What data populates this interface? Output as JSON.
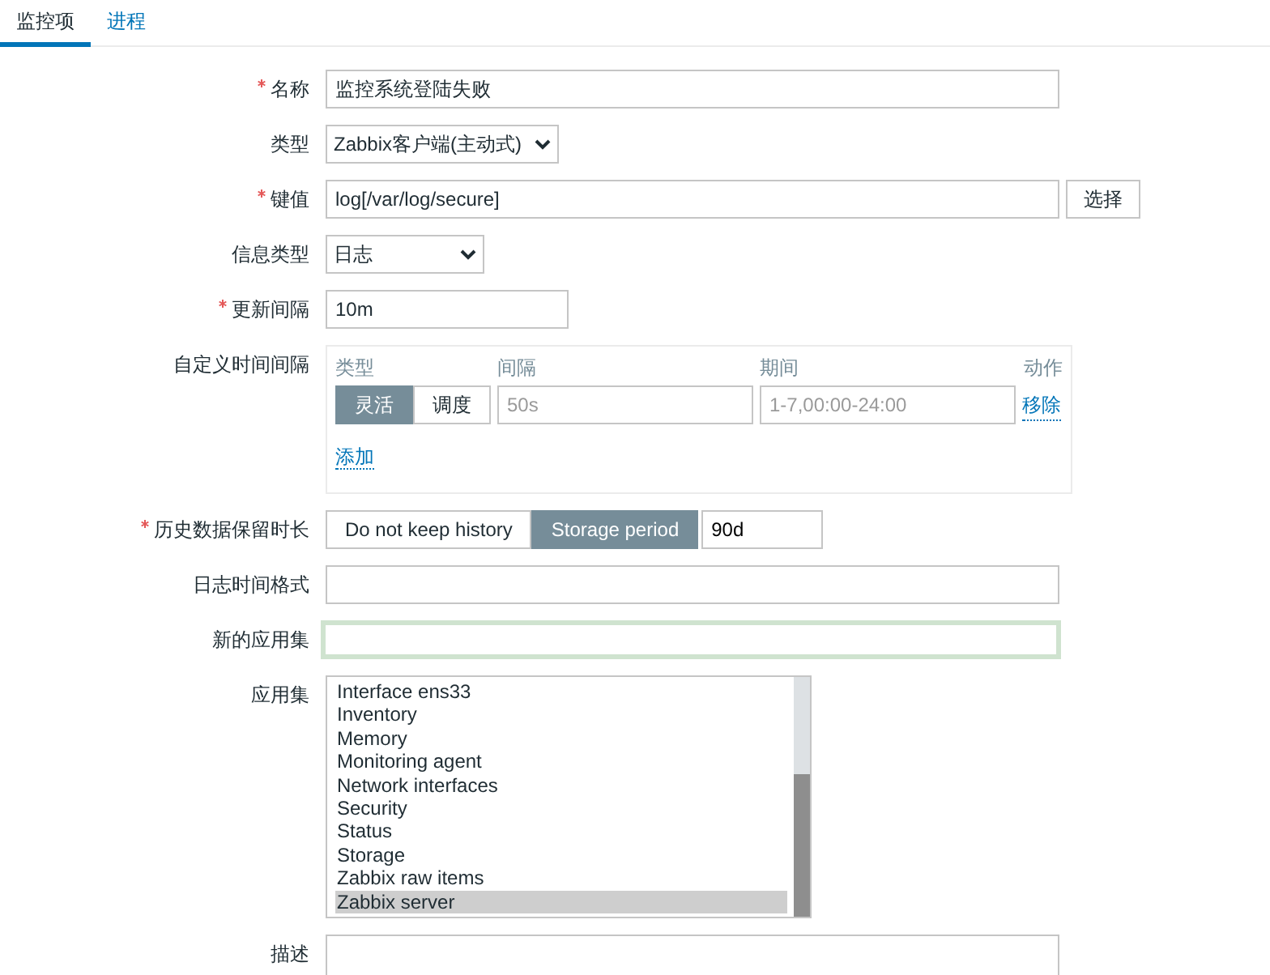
{
  "tabs": [
    {
      "label": "监控项",
      "selected": true
    },
    {
      "label": "进程",
      "selected": false
    }
  ],
  "form": {
    "rows": [
      {
        "kind": "text",
        "label": "名称",
        "required": true,
        "value": "监控系统登陆失败"
      },
      {
        "kind": "select",
        "label": "类型",
        "required": false,
        "value": "Zabbix客户端(主动式)"
      },
      {
        "kind": "key",
        "label": "键值",
        "required": true,
        "value": "log[/var/log/secure]",
        "button": "选择"
      },
      {
        "kind": "select",
        "label": "信息类型",
        "required": false,
        "value": "日志"
      },
      {
        "kind": "short_text",
        "label": "更新间隔",
        "required": true,
        "value": "10m"
      },
      {
        "kind": "intervals",
        "label": "自定义时间间隔",
        "required": false,
        "columns": [
          "类型",
          "间隔",
          "期间",
          "动作"
        ],
        "rows": [
          {
            "modes": [
              {
                "label": "灵活",
                "selected": true
              },
              {
                "label": "调度",
                "selected": false
              }
            ],
            "interval_placeholder": "50s",
            "period_placeholder": "1-7,00:00-24:00",
            "remove": "移除"
          }
        ],
        "add": "添加"
      },
      {
        "kind": "history",
        "label": "历史数据保留时长",
        "required": true,
        "options": [
          {
            "label": "Do not keep history",
            "selected": false
          },
          {
            "label": "Storage period",
            "selected": true
          }
        ],
        "value": "90d"
      },
      {
        "kind": "text",
        "label": "日志时间格式",
        "required": false,
        "value": ""
      },
      {
        "kind": "focused",
        "label": "新的应用集",
        "required": false,
        "value": ""
      },
      {
        "kind": "list",
        "label": "应用集",
        "required": false,
        "items": [
          {
            "label": "Interface ens33",
            "selected": false
          },
          {
            "label": "Inventory",
            "selected": false
          },
          {
            "label": "Memory",
            "selected": false
          },
          {
            "label": "Monitoring agent",
            "selected": false
          },
          {
            "label": "Network interfaces",
            "selected": false
          },
          {
            "label": "Security",
            "selected": false
          },
          {
            "label": "Status",
            "selected": false
          },
          {
            "label": "Storage",
            "selected": false
          },
          {
            "label": "Zabbix raw items",
            "selected": false
          },
          {
            "label": "Zabbix server",
            "selected": true
          }
        ]
      },
      {
        "kind": "textarea",
        "label": "描述",
        "required": false,
        "value": ""
      }
    ]
  }
}
